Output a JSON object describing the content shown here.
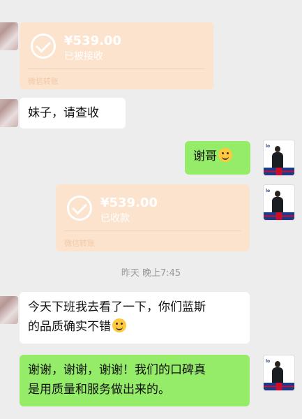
{
  "messages": {
    "t1": {
      "amount": "¥539.00",
      "status": "已被接收",
      "footer": "微信转账"
    },
    "m1": "妹子，请查收",
    "m2": "谢哥",
    "t2": {
      "amount": "¥539.00",
      "status": "已收款",
      "footer": "微信转账"
    },
    "timestamp": "昨天 晚上7:45",
    "m3_line1": "今天下班我去看了一下，你们蓝斯",
    "m3_line2": "的品质确实不错",
    "m4_line1": "谢谢，谢谢，谢谢！我们的口碑真",
    "m4_line2": "是用质量和服务做出来的。"
  }
}
